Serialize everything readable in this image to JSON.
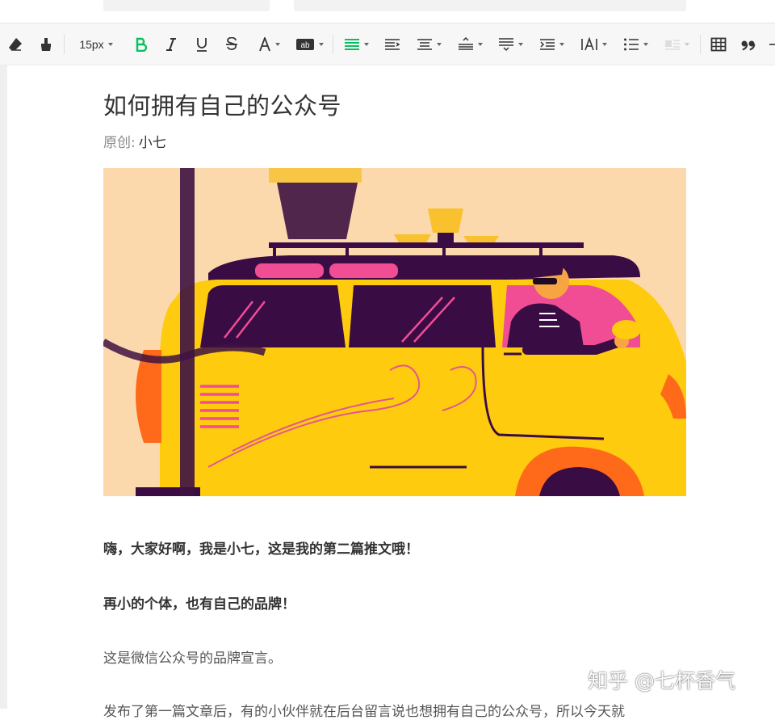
{
  "toolbar": {
    "font_size": "15px",
    "items": [
      {
        "name": "clear-format"
      },
      {
        "name": "format-painter"
      },
      {
        "name": "font-size"
      },
      {
        "name": "bold"
      },
      {
        "name": "italic"
      },
      {
        "name": "underline"
      },
      {
        "name": "strikethrough"
      },
      {
        "name": "font-color"
      },
      {
        "name": "background-color"
      },
      {
        "name": "align"
      },
      {
        "name": "indent"
      },
      {
        "name": "align-center"
      },
      {
        "name": "line-height"
      },
      {
        "name": "paragraph-spacing"
      },
      {
        "name": "indent-first-line"
      },
      {
        "name": "letter-spacing"
      },
      {
        "name": "list"
      },
      {
        "name": "image-position"
      },
      {
        "name": "table"
      },
      {
        "name": "quote"
      }
    ],
    "accent_color": "#07c160"
  },
  "article": {
    "title": "如何拥有自己的公众号",
    "byline_label": "原创:",
    "author": "小七",
    "paragraphs": [
      "嗨，大家好啊，我是小七，这是我的第二篇推文哦！",
      "再小的个体，也有自己的品牌！",
      "这是微信公众号的品牌宣言。",
      "发布了第一篇文章后，有的小伙伴就在后台留言说也想拥有自己的公众号，所以今天就"
    ]
  },
  "watermark": "知乎 @七杯香气"
}
